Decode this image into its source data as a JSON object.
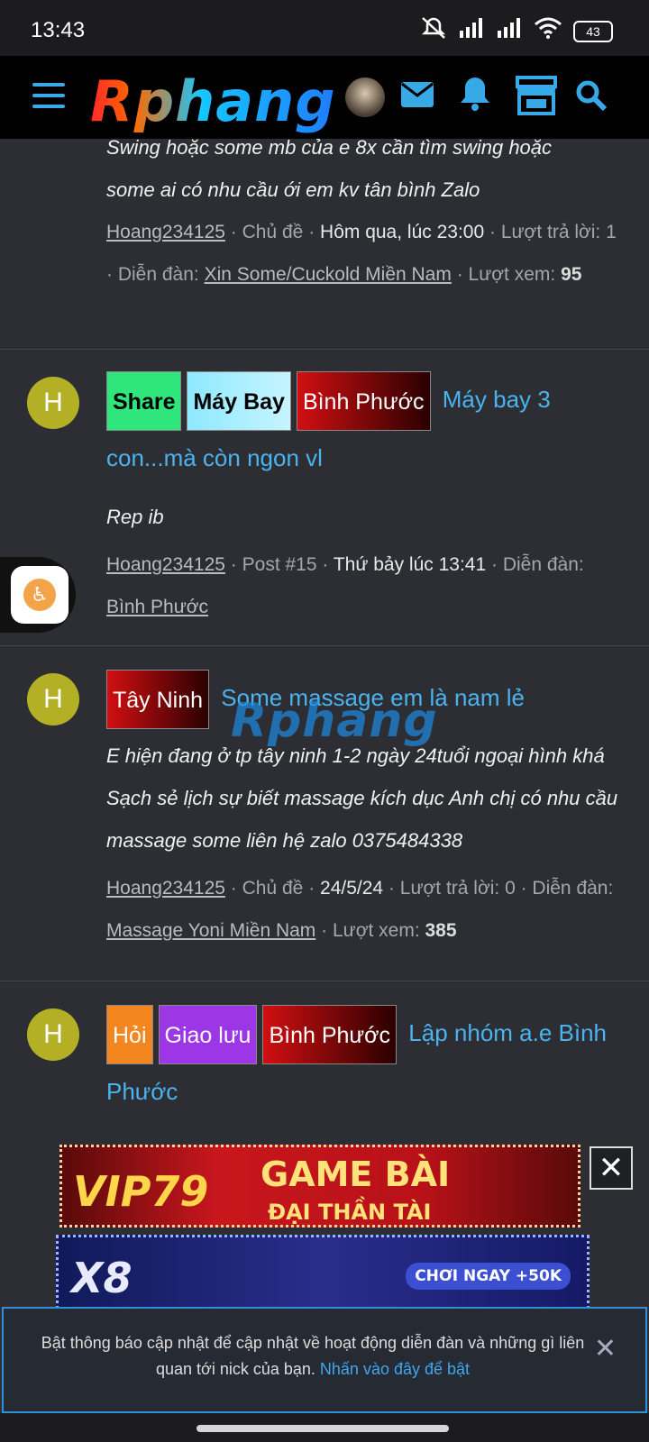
{
  "status": {
    "time": "13:43",
    "battery": "43"
  },
  "header": {
    "logo": "Rphang"
  },
  "items": [
    {
      "snippet_lines": [
        "Swing hoặc some mb của e 8x cần tìm swing hoặc",
        "some ai có nhu cầu ới em kv tân bình Zalo"
      ],
      "user": "Hoang234125",
      "type": "Chủ đề",
      "date": "Hôm qua, lúc 23:00",
      "replies_label": "Lượt trả lời: 1",
      "forum_label": "Diễn đàn:",
      "forum": "Xin Some/Cuckold Miền Nam",
      "views_label": "Lượt xem:",
      "views": "95"
    },
    {
      "avatar": "H",
      "tags": [
        "Share",
        "Máy Bay",
        "Bình Phước"
      ],
      "title": "Máy bay 3 con...mà còn ngon vl",
      "snippet": "Rep ib",
      "user": "Hoang234125",
      "post": "Post #15",
      "date": "Thứ bảy lúc 13:41",
      "forum_label": "Diễn đàn:",
      "forum": "Bình Phước"
    },
    {
      "avatar": "H",
      "tags": [
        "Tây Ninh"
      ],
      "title": "Some massage em là nam lẻ",
      "snippet": "E hiện đang ở tp tây ninh 1-2 ngày 24tuổi ngoại hình khá Sạch sẻ lịch sự biết massage kích dục Anh chị có nhu cầu massage some liên hệ zalo 0375484338",
      "user": "Hoang234125",
      "type": "Chủ đề",
      "date": "24/5/24",
      "replies_label": "Lượt trả lời: 0",
      "forum_label": "Diễn đàn:",
      "forum": "Massage Yoni Miền Nam",
      "views_label": "Lượt xem:",
      "views": "385"
    },
    {
      "avatar": "H",
      "tags": [
        "Hỏi",
        "Giao lưu",
        "Bình Phước"
      ],
      "title": "Lập nhóm a.e Bình Phước"
    }
  ],
  "watermark": "Rphang",
  "ads": {
    "vip": {
      "logo": "VIP79",
      "headline": "GAME BÀI",
      "sub": "ĐẠI THẦN TÀI",
      "close": "✕"
    },
    "x8": {
      "logo": "X8",
      "cta": "CHƠI NGAY +50K"
    }
  },
  "notice": {
    "text": "Bật thông báo cập nhật để cập nhật về hoạt động diễn đàn và những gì liên quan tới nick của bạn.",
    "link": "Nhấn vào đây để bật",
    "close": "✕"
  }
}
